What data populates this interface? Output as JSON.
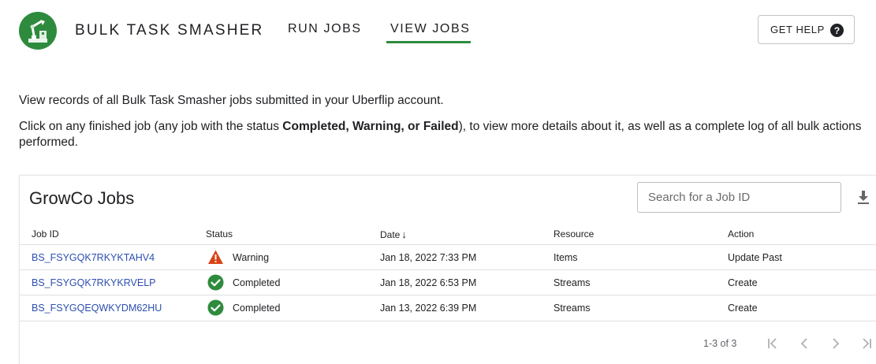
{
  "header": {
    "app_title": "BULK TASK SMASHER",
    "tabs": [
      {
        "label": "RUN JOBS",
        "active": false
      },
      {
        "label": "VIEW JOBS",
        "active": true
      }
    ],
    "help_label": "GET HELP",
    "help_icon": "question-circle-icon",
    "logo_icon": "robot-arm-logo-icon",
    "accent_color": "#2e8b3d"
  },
  "intro": {
    "line1": "View records of all Bulk Task Smasher jobs submitted in your Uberflip account.",
    "line2_prefix": "Click on any finished job (any job with the status ",
    "line2_bold": "Completed, Warning, or Failed",
    "line2_suffix": "), to view more details about it, as well as a complete log of all bulk actions performed."
  },
  "jobs_card": {
    "title": "GrowCo Jobs",
    "search_placeholder": "Search for a Job ID",
    "download_icon": "download-icon",
    "columns": [
      "Job ID",
      "Status",
      "Date",
      "Resource",
      "Action"
    ],
    "sort_icon": "arrow-down-icon",
    "rows": [
      {
        "job_id": "BS_FSYGQK7RKYKTAHV4",
        "status": "Warning",
        "status_icon": "warning-triangle-icon",
        "date": "Jan 18, 2022 7:33 PM",
        "resource": "Items",
        "action": "Update Past"
      },
      {
        "job_id": "BS_FSYGQK7RKYKRVELP",
        "status": "Completed",
        "status_icon": "check-circle-icon",
        "date": "Jan 18, 2022 6:53 PM",
        "resource": "Streams",
        "action": "Create"
      },
      {
        "job_id": "BS_FSYGQEQWKYDM62HU",
        "status": "Completed",
        "status_icon": "check-circle-icon",
        "date": "Jan 13, 2022 6:39 PM",
        "resource": "Streams",
        "action": "Create"
      }
    ],
    "pagination": {
      "text": "1-3 of 3"
    }
  },
  "colors": {
    "link": "#2d4fb0",
    "warning": "#d84315",
    "success": "#2e8b3d"
  }
}
